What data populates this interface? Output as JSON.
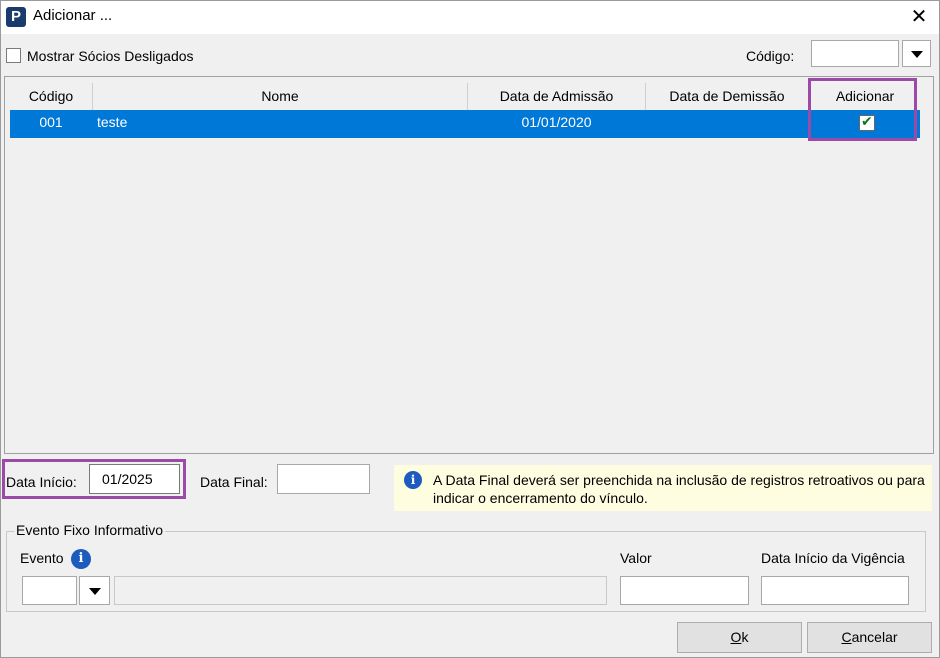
{
  "window": {
    "title": "Adicionar ...",
    "logo_letter": "P"
  },
  "filters": {
    "show_dismissed_label": "Mostrar Sócios Desligados",
    "show_dismissed_checked": false,
    "code_label": "Código:",
    "code_value": ""
  },
  "grid": {
    "columns": [
      "Código",
      "Nome",
      "Data de Admissão",
      "Data de Demissão",
      "Adicionar"
    ],
    "rows": [
      {
        "codigo": "001",
        "nome": "teste",
        "admissao": "01/01/2020",
        "demissao": "",
        "adicionar": true,
        "selected": true
      }
    ]
  },
  "dates": {
    "start_label": "Data Início:",
    "start_value": "01/2025",
    "end_label": "Data Final:",
    "end_value": "",
    "info_text": "A Data Final deverá ser preenchida na inclusão de registros retroativos ou para indicar o encerramento do vínculo."
  },
  "event_group": {
    "title": "Evento Fixo Informativo",
    "event_label": "Evento",
    "event_code": "",
    "event_description": "",
    "value_label": "Valor",
    "value": "",
    "validity_label": "Data Início da Vigência",
    "validity_value": ""
  },
  "buttons": {
    "ok_first": "O",
    "ok_rest": "k",
    "cancel_first": "C",
    "cancel_rest": "ancelar"
  },
  "colors": {
    "selection": "#0078d7",
    "highlight": "#9b4ba7",
    "info_bg": "#fffde0"
  },
  "icons": [
    "app-logo-icon",
    "close-icon",
    "chevron-down-icon",
    "info-icon",
    "check-icon"
  ]
}
